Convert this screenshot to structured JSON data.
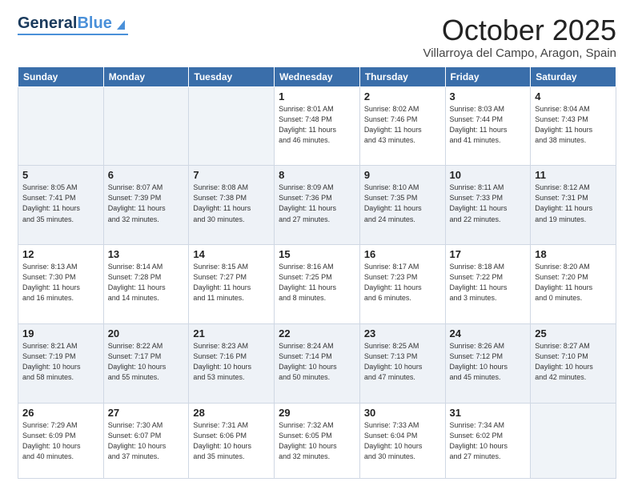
{
  "header": {
    "logo_general": "General",
    "logo_blue": "Blue",
    "month_title": "October 2025",
    "location": "Villarroya del Campo, Aragon, Spain"
  },
  "days_of_week": [
    "Sunday",
    "Monday",
    "Tuesday",
    "Wednesday",
    "Thursday",
    "Friday",
    "Saturday"
  ],
  "weeks": [
    [
      {
        "day": "",
        "info": ""
      },
      {
        "day": "",
        "info": ""
      },
      {
        "day": "",
        "info": ""
      },
      {
        "day": "1",
        "info": "Sunrise: 8:01 AM\nSunset: 7:48 PM\nDaylight: 11 hours\nand 46 minutes."
      },
      {
        "day": "2",
        "info": "Sunrise: 8:02 AM\nSunset: 7:46 PM\nDaylight: 11 hours\nand 43 minutes."
      },
      {
        "day": "3",
        "info": "Sunrise: 8:03 AM\nSunset: 7:44 PM\nDaylight: 11 hours\nand 41 minutes."
      },
      {
        "day": "4",
        "info": "Sunrise: 8:04 AM\nSunset: 7:43 PM\nDaylight: 11 hours\nand 38 minutes."
      }
    ],
    [
      {
        "day": "5",
        "info": "Sunrise: 8:05 AM\nSunset: 7:41 PM\nDaylight: 11 hours\nand 35 minutes."
      },
      {
        "day": "6",
        "info": "Sunrise: 8:07 AM\nSunset: 7:39 PM\nDaylight: 11 hours\nand 32 minutes."
      },
      {
        "day": "7",
        "info": "Sunrise: 8:08 AM\nSunset: 7:38 PM\nDaylight: 11 hours\nand 30 minutes."
      },
      {
        "day": "8",
        "info": "Sunrise: 8:09 AM\nSunset: 7:36 PM\nDaylight: 11 hours\nand 27 minutes."
      },
      {
        "day": "9",
        "info": "Sunrise: 8:10 AM\nSunset: 7:35 PM\nDaylight: 11 hours\nand 24 minutes."
      },
      {
        "day": "10",
        "info": "Sunrise: 8:11 AM\nSunset: 7:33 PM\nDaylight: 11 hours\nand 22 minutes."
      },
      {
        "day": "11",
        "info": "Sunrise: 8:12 AM\nSunset: 7:31 PM\nDaylight: 11 hours\nand 19 minutes."
      }
    ],
    [
      {
        "day": "12",
        "info": "Sunrise: 8:13 AM\nSunset: 7:30 PM\nDaylight: 11 hours\nand 16 minutes."
      },
      {
        "day": "13",
        "info": "Sunrise: 8:14 AM\nSunset: 7:28 PM\nDaylight: 11 hours\nand 14 minutes."
      },
      {
        "day": "14",
        "info": "Sunrise: 8:15 AM\nSunset: 7:27 PM\nDaylight: 11 hours\nand 11 minutes."
      },
      {
        "day": "15",
        "info": "Sunrise: 8:16 AM\nSunset: 7:25 PM\nDaylight: 11 hours\nand 8 minutes."
      },
      {
        "day": "16",
        "info": "Sunrise: 8:17 AM\nSunset: 7:23 PM\nDaylight: 11 hours\nand 6 minutes."
      },
      {
        "day": "17",
        "info": "Sunrise: 8:18 AM\nSunset: 7:22 PM\nDaylight: 11 hours\nand 3 minutes."
      },
      {
        "day": "18",
        "info": "Sunrise: 8:20 AM\nSunset: 7:20 PM\nDaylight: 11 hours\nand 0 minutes."
      }
    ],
    [
      {
        "day": "19",
        "info": "Sunrise: 8:21 AM\nSunset: 7:19 PM\nDaylight: 10 hours\nand 58 minutes."
      },
      {
        "day": "20",
        "info": "Sunrise: 8:22 AM\nSunset: 7:17 PM\nDaylight: 10 hours\nand 55 minutes."
      },
      {
        "day": "21",
        "info": "Sunrise: 8:23 AM\nSunset: 7:16 PM\nDaylight: 10 hours\nand 53 minutes."
      },
      {
        "day": "22",
        "info": "Sunrise: 8:24 AM\nSunset: 7:14 PM\nDaylight: 10 hours\nand 50 minutes."
      },
      {
        "day": "23",
        "info": "Sunrise: 8:25 AM\nSunset: 7:13 PM\nDaylight: 10 hours\nand 47 minutes."
      },
      {
        "day": "24",
        "info": "Sunrise: 8:26 AM\nSunset: 7:12 PM\nDaylight: 10 hours\nand 45 minutes."
      },
      {
        "day": "25",
        "info": "Sunrise: 8:27 AM\nSunset: 7:10 PM\nDaylight: 10 hours\nand 42 minutes."
      }
    ],
    [
      {
        "day": "26",
        "info": "Sunrise: 7:29 AM\nSunset: 6:09 PM\nDaylight: 10 hours\nand 40 minutes."
      },
      {
        "day": "27",
        "info": "Sunrise: 7:30 AM\nSunset: 6:07 PM\nDaylight: 10 hours\nand 37 minutes."
      },
      {
        "day": "28",
        "info": "Sunrise: 7:31 AM\nSunset: 6:06 PM\nDaylight: 10 hours\nand 35 minutes."
      },
      {
        "day": "29",
        "info": "Sunrise: 7:32 AM\nSunset: 6:05 PM\nDaylight: 10 hours\nand 32 minutes."
      },
      {
        "day": "30",
        "info": "Sunrise: 7:33 AM\nSunset: 6:04 PM\nDaylight: 10 hours\nand 30 minutes."
      },
      {
        "day": "31",
        "info": "Sunrise: 7:34 AM\nSunset: 6:02 PM\nDaylight: 10 hours\nand 27 minutes."
      },
      {
        "day": "",
        "info": ""
      }
    ]
  ],
  "shaded_rows": [
    1,
    3
  ],
  "colors": {
    "header_bg": "#3a6eaa",
    "shaded_row": "#eef2f7",
    "empty_cell": "#f0f4f8"
  }
}
